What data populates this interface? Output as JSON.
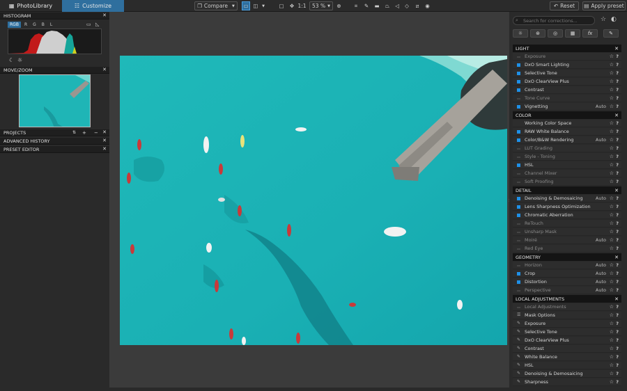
{
  "header": {
    "tabs": [
      {
        "label": "PhotoLibrary",
        "icon": "grid-icon"
      },
      {
        "label": "Customize",
        "icon": "sliders-icon"
      }
    ],
    "compare_label": "Compare",
    "one_to_one_label": "1:1",
    "zoom_value": "53 %",
    "reset_label": "Reset",
    "apply_preset_label": "Apply preset"
  },
  "left_panel": {
    "histogram_title": "HISTOGRAM",
    "channels": [
      "RGB",
      "R",
      "G",
      "B",
      "L"
    ],
    "movezoom_title": "MOVE/ZOOM",
    "projects_title": "PROJECTS",
    "advanced_history_title": "ADVANCED HISTORY",
    "preset_editor_title": "PRESET EDITOR"
  },
  "right_panel": {
    "search_placeholder": "Search for corrections...",
    "sections": [
      {
        "title": "LIGHT",
        "items": [
          {
            "label": "Exposure",
            "state": "off",
            "auto": ""
          },
          {
            "label": "DxO Smart Lighting",
            "state": "on",
            "auto": ""
          },
          {
            "label": "Selective Tone",
            "state": "on",
            "auto": ""
          },
          {
            "label": "DxO ClearView Plus",
            "state": "on",
            "auto": ""
          },
          {
            "label": "Contrast",
            "state": "on",
            "auto": ""
          },
          {
            "label": "Tone Curve",
            "state": "off",
            "auto": ""
          },
          {
            "label": "Vignetting",
            "state": "on",
            "auto": "Auto"
          }
        ]
      },
      {
        "title": "COLOR",
        "items": [
          {
            "label": "Working Color Space",
            "state": "none",
            "auto": ""
          },
          {
            "label": "RAW White Balance",
            "state": "on",
            "auto": ""
          },
          {
            "label": "Color/B&W Rendering",
            "state": "on",
            "auto": "Auto"
          },
          {
            "label": "LUT Grading",
            "state": "off",
            "auto": ""
          },
          {
            "label": "Style - Toning",
            "state": "off",
            "auto": ""
          },
          {
            "label": "HSL",
            "state": "on",
            "auto": ""
          },
          {
            "label": "Channel Mixer",
            "state": "off",
            "auto": ""
          },
          {
            "label": "Soft Proofing",
            "state": "off",
            "auto": ""
          }
        ]
      },
      {
        "title": "DETAIL",
        "items": [
          {
            "label": "Denoising & Demosaicing",
            "state": "on",
            "auto": "Auto"
          },
          {
            "label": "Lens Sharpness Optimization",
            "state": "on",
            "auto": ""
          },
          {
            "label": "Chromatic Aberration",
            "state": "on",
            "auto": ""
          },
          {
            "label": "ReTouch",
            "state": "off",
            "auto": ""
          },
          {
            "label": "Unsharp Mask",
            "state": "off",
            "auto": ""
          },
          {
            "label": "Moiré",
            "state": "off",
            "auto": "Auto"
          },
          {
            "label": "Red Eye",
            "state": "off",
            "auto": ""
          }
        ]
      },
      {
        "title": "GEOMETRY",
        "items": [
          {
            "label": "Horizon",
            "state": "off",
            "auto": "Auto"
          },
          {
            "label": "Crop",
            "state": "on",
            "auto": "Auto"
          },
          {
            "label": "Distortion",
            "state": "on",
            "auto": "Auto"
          },
          {
            "label": "Perspective",
            "state": "off",
            "auto": "Auto"
          }
        ]
      },
      {
        "title": "LOCAL ADJUSTMENTS",
        "items": [
          {
            "label": "Local Adjustments",
            "state": "off",
            "auto": ""
          },
          {
            "label": "Mask Options",
            "state": "mask",
            "auto": ""
          },
          {
            "label": "Exposure",
            "state": "pen",
            "auto": ""
          },
          {
            "label": "Selective Tone",
            "state": "pen",
            "auto": ""
          },
          {
            "label": "DxO ClearView Plus",
            "state": "pen",
            "auto": ""
          },
          {
            "label": "Contrast",
            "state": "pen",
            "auto": ""
          },
          {
            "label": "White Balance",
            "state": "pen",
            "auto": ""
          },
          {
            "label": "HSL",
            "state": "pen",
            "auto": ""
          },
          {
            "label": "Denoising & Demosaicing",
            "state": "pen",
            "auto": ""
          },
          {
            "label": "Sharpness",
            "state": "pen",
            "auto": ""
          }
        ]
      }
    ]
  },
  "colors": {
    "accent": "#2f6f9e",
    "active_indicator": "#1e90e8",
    "water": "#1fb8b8"
  }
}
